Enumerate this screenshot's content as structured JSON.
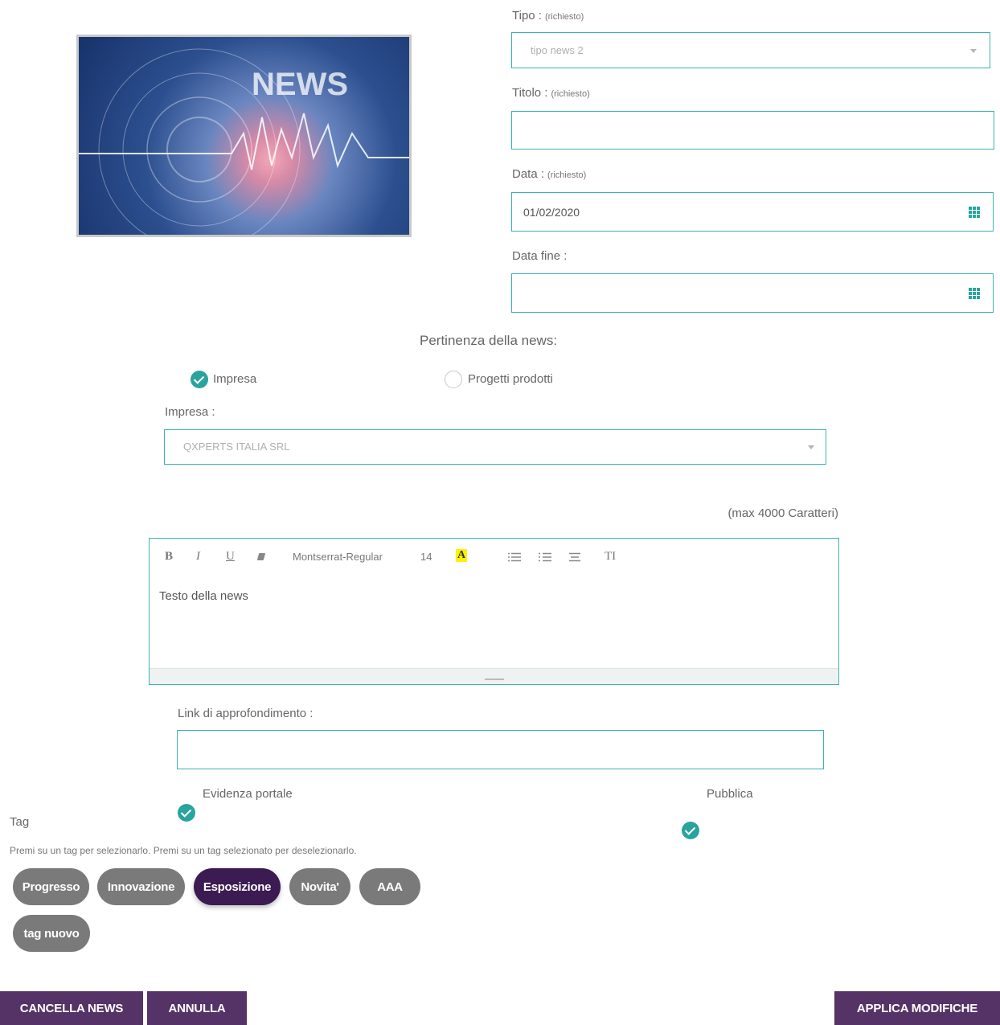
{
  "image": {
    "alt": "NEWS"
  },
  "tipo": {
    "label": "Tipo :",
    "required": "(richiesto)",
    "value": "tipo news 2"
  },
  "titolo": {
    "label": "Titolo :",
    "required": "(richiesto)",
    "value": ""
  },
  "data": {
    "label": "Data :",
    "required": "(richiesto)",
    "value": "01/02/2020"
  },
  "data_fine": {
    "label": "Data fine :",
    "value": ""
  },
  "pertinenza": {
    "title": "Pertinenza della news:",
    "option1": "Impresa",
    "option2": "Progetti prodotti"
  },
  "impresa": {
    "label": "Impresa :",
    "value": "QXPERTS ITALIA SRL"
  },
  "max_chars": "(max 4000 Caratteri)",
  "editor": {
    "bold": "B",
    "italic": "I",
    "underline": "U",
    "font": "Montserrat-Regular",
    "size": "14",
    "color_btn": "A",
    "text_style": "TI",
    "content": "Testo della news"
  },
  "link": {
    "label": "Link di approfondimento :",
    "value": ""
  },
  "evidenza": "Evidenza portale",
  "pubblica": "Pubblica",
  "tags": {
    "title": "Tag",
    "help": "Premi su un tag per selezionarlo. Premi su un tag selezionato per deselezionarlo.",
    "items": [
      "Progresso",
      "Innovazione",
      "Esposizione",
      "Novita'",
      "AAA",
      "tag nuovo"
    ]
  },
  "buttons": {
    "delete": "CANCELLA NEWS",
    "cancel": "ANNULLA",
    "apply": "APPLICA MODIFICHE"
  },
  "colors": {
    "accent": "#2aa39e",
    "button": "#553366",
    "tag": "#7a7a7a",
    "tag_selected": "#3b1b52"
  }
}
